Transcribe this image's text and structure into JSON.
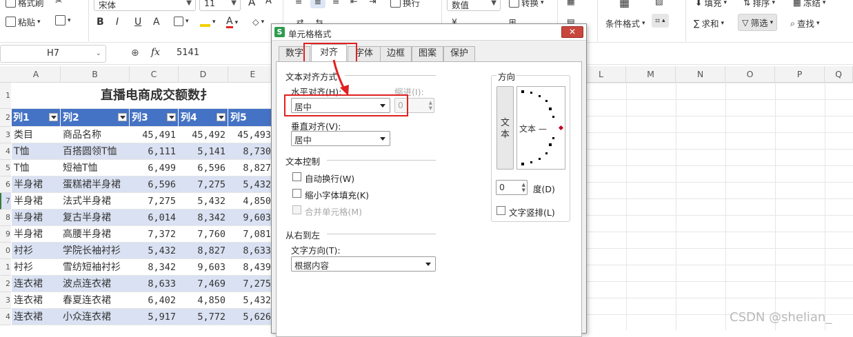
{
  "ribbon": {
    "format_painter": "格式刷",
    "paste": "粘贴",
    "font_name": "宋体",
    "font_size": "11",
    "wrap": "换行",
    "number_format": "数值",
    "convert": "转换",
    "fill": "填充",
    "sort": "排序",
    "freeze": "冻结",
    "conditional_format": "条件格式",
    "sum": "求和",
    "filter": "筛选",
    "find": "查找"
  },
  "formula_bar": {
    "name_box": "H7",
    "fx": "fx",
    "value": "5141"
  },
  "columns": [
    "A",
    "B",
    "C",
    "D",
    "E",
    "L",
    "M",
    "N",
    "O",
    "P",
    "Q"
  ],
  "row_numbers": [
    "1",
    "2",
    "3",
    "4",
    "5",
    "6",
    "7",
    "8",
    "9",
    "0",
    "1",
    "2",
    "3",
    "4"
  ],
  "sheet": {
    "title": "直播电商成交额数扌",
    "header": [
      "列1",
      "列2",
      "列3",
      "列4",
      "列5"
    ],
    "rows": [
      [
        "类目",
        "商品名称",
        "45,491",
        "45,492",
        "45,493"
      ],
      [
        "T恤",
        "百搭圆领T恤",
        "6,111",
        "5,141",
        "8,730"
      ],
      [
        "T恤",
        "短袖T恤",
        "6,499",
        "6,596",
        "8,827"
      ],
      [
        "半身裙",
        "蛋糕裙半身裙",
        "6,596",
        "7,275",
        "5,432"
      ],
      [
        "半身裙",
        "法式半身裙",
        "7,275",
        "5,432",
        "4,850"
      ],
      [
        "半身裙",
        "复古半身裙",
        "6,014",
        "8,342",
        "9,603"
      ],
      [
        "半身裙",
        "高腰半身裙",
        "7,372",
        "7,760",
        "7,081"
      ],
      [
        "衬衫",
        "学院长袖衬衫",
        "5,432",
        "8,827",
        "8,633"
      ],
      [
        "衬衫",
        "雪纺短袖衬衫",
        "8,342",
        "9,603",
        "8,439"
      ],
      [
        "连衣裙",
        "波点连衣裙",
        "8,633",
        "7,469",
        "7,275"
      ],
      [
        "连衣裙",
        "春夏连衣裙",
        "6,402",
        "4,850",
        "5,432"
      ],
      [
        "连衣裙",
        "小众连衣裙",
        "5,917",
        "5,772",
        "5,626"
      ]
    ]
  },
  "dialog": {
    "title": "单元格格式",
    "tabs": [
      "数字",
      "对齐",
      "字体",
      "边框",
      "图案",
      "保护"
    ],
    "active_tab": "对齐",
    "text_alignment_group": "文本对齐方式",
    "horizontal_label": "水平对齐(H):",
    "horizontal_value": "居中",
    "indent_label": "缩进(I):",
    "indent_value": "0",
    "vertical_label": "垂直对齐(V):",
    "vertical_value": "居中",
    "text_control_group": "文本控制",
    "wrap_text": "自动换行(W)",
    "shrink_to_fit": "缩小字体填充(K)",
    "merge_cells": "合并单元格(M)",
    "rtl_group": "从右到左",
    "text_direction_label": "文字方向(T):",
    "text_direction_value": "根据内容",
    "orientation_group": "方向",
    "vertical_text_char1": "文",
    "vertical_text_char2": "本",
    "dial_text": "文本 —",
    "degree_value": "0",
    "degree_label": "度(D)",
    "vertical_stack": "文字竖排(L)"
  },
  "watermark": "CSDN @shelian_",
  "colors": {
    "accent": "#4472c4",
    "band": "#d9e1f2",
    "highlight": "#e02020"
  }
}
